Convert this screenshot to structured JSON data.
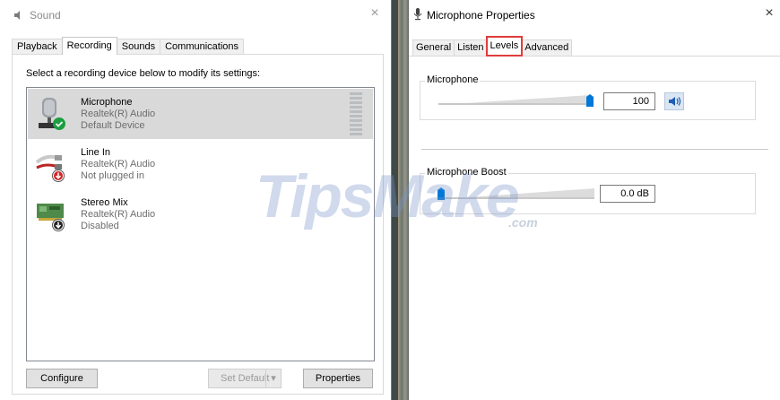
{
  "sound": {
    "title": "Sound",
    "close": "×",
    "tabs": [
      "Playback",
      "Recording",
      "Sounds",
      "Communications"
    ],
    "active_tab": "Recording",
    "instruction": "Select a recording device below to modify its settings:",
    "devices": [
      {
        "name": "Microphone",
        "driver": "Realtek(R) Audio",
        "status": "Default Device",
        "icon": "microphone-icon",
        "badge": "check-badge-icon",
        "selected": true
      },
      {
        "name": "Line In",
        "driver": "Realtek(R) Audio",
        "status": "Not plugged in",
        "icon": "line-in-cable-icon",
        "badge": "down-arrow-red-badge-icon",
        "selected": false
      },
      {
        "name": "Stereo Mix",
        "driver": "Realtek(R) Audio",
        "status": "Disabled",
        "icon": "sound-card-icon",
        "badge": "down-arrow-badge-icon",
        "selected": false
      }
    ],
    "buttons": {
      "configure": "Configure",
      "set_default": "Set Default",
      "properties": "Properties"
    }
  },
  "props": {
    "title": "Microphone Properties",
    "close": "×",
    "tabs": [
      "General",
      "Listen",
      "Levels",
      "Advanced"
    ],
    "active_tab": "Levels",
    "microphone": {
      "label": "Microphone",
      "value": "100",
      "level": 1.0
    },
    "boost": {
      "label": "Microphone Boost",
      "value": "0.0 dB",
      "level": 0.0
    }
  },
  "watermark": {
    "main": "TipsMake",
    "domain": ".com"
  },
  "colors": {
    "accent": "#0078d7",
    "check": "#1a9e3f",
    "highlight_tab": "#e03c3c"
  }
}
